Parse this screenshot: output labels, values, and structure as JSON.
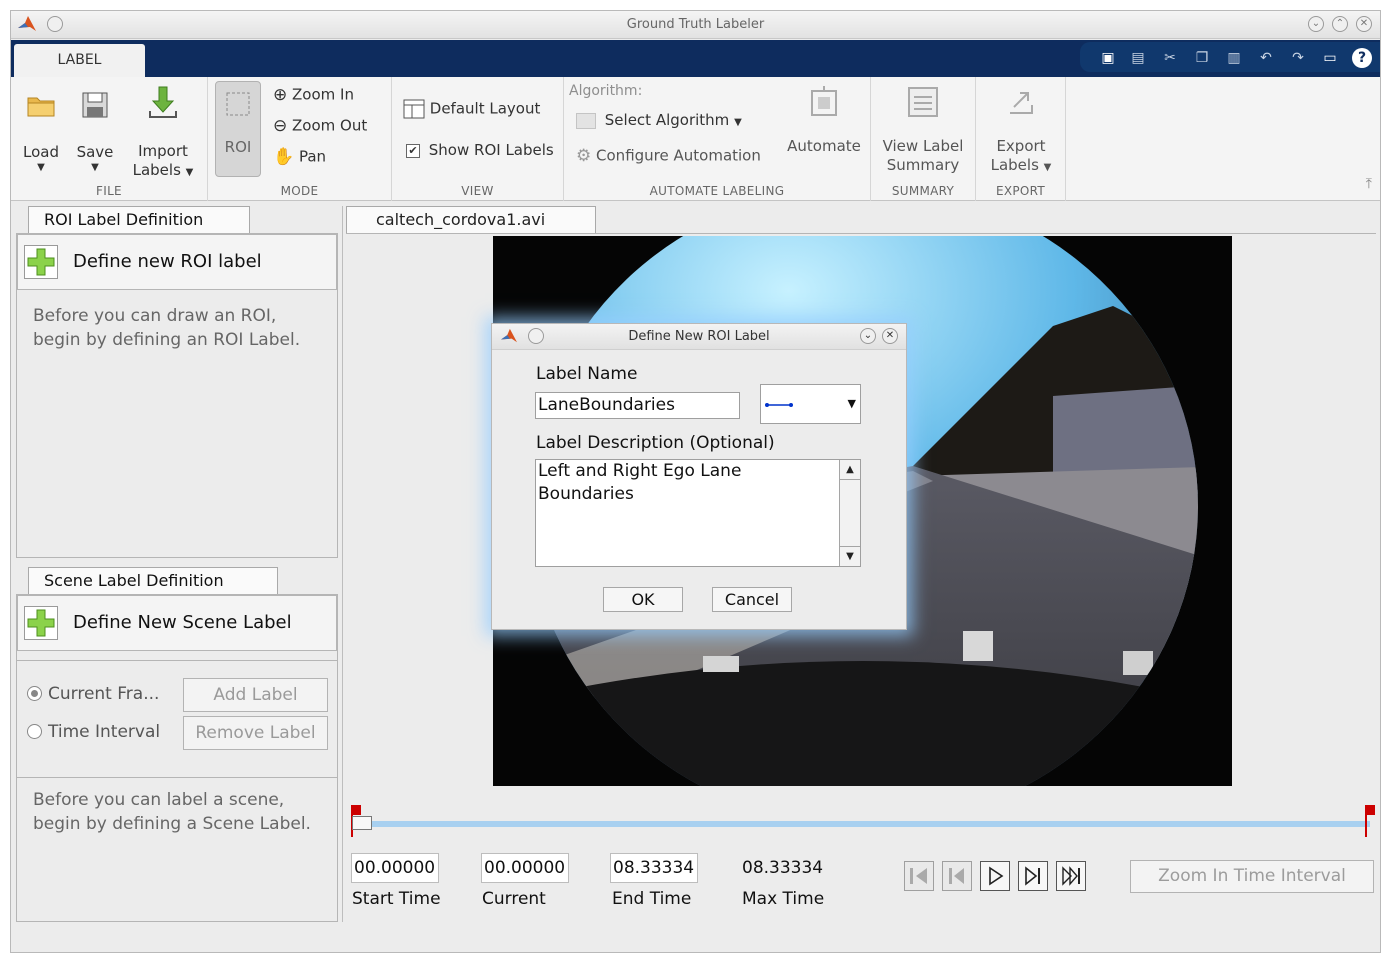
{
  "window": {
    "title": "Ground Truth Labeler"
  },
  "toolstrip": {
    "tab": "LABEL",
    "groups": {
      "file": "FILE",
      "mode": "MODE",
      "view": "VIEW",
      "automate": "AUTOMATE LABELING",
      "summary": "SUMMARY",
      "export": "EXPORT"
    },
    "load": "Load",
    "save": "Save",
    "import_line1": "Import",
    "import_line2": "Labels",
    "roi": "ROI",
    "zoom_in": "Zoom In",
    "zoom_out": "Zoom Out",
    "pan": "Pan",
    "default_layout": "Default Layout",
    "show_roi_labels": "Show ROI Labels",
    "algorithm_label": "Algorithm:",
    "select_algorithm": "Select Algorithm",
    "configure_automation": "Configure Automation",
    "automate": "Automate",
    "view_label_line1": "View Label",
    "view_label_line2": "Summary",
    "export_line1": "Export",
    "export_line2": "Labels"
  },
  "roi_panel": {
    "tab": "ROI Label Definition",
    "define_button": "Define new ROI label",
    "help_line1": "Before you can draw an ROI,",
    "help_line2": "begin by defining an ROI Label."
  },
  "scene_panel": {
    "tab": "Scene Label Definition",
    "define_button": "Define New Scene Label",
    "radio_current": "Current Fra...",
    "radio_interval": "Time Interval",
    "add_label": "Add Label",
    "remove_label": "Remove Label",
    "help_line1": "Before you can label a scene,",
    "help_line2": "begin by defining a Scene Label."
  },
  "document": {
    "tab": "caltech_cordova1.avi"
  },
  "timeline": {
    "start_time": "00.00000",
    "current": "00.00000",
    "end_time": "08.33334",
    "max_time": "08.33334",
    "start_label": "Start Time",
    "current_label": "Current",
    "end_label": "End Time",
    "max_label": "Max Time",
    "zoom_interval": "Zoom In Time Interval"
  },
  "dialog": {
    "title": "Define New ROI Label",
    "label_name_caption": "Label Name",
    "label_name_value": "LaneBoundaries",
    "description_caption": "Label Description (Optional)",
    "description_value": "Left and Right Ego Lane\nBoundaries",
    "ok": "OK",
    "cancel": "Cancel"
  },
  "colors": {
    "toolstrip_dark": "#0e2c5e",
    "slider_track": "#a8d0f0",
    "marker_red": "#cc0000",
    "dialog_glow": "#96cdff",
    "line_type_blue": "#0033cc"
  }
}
